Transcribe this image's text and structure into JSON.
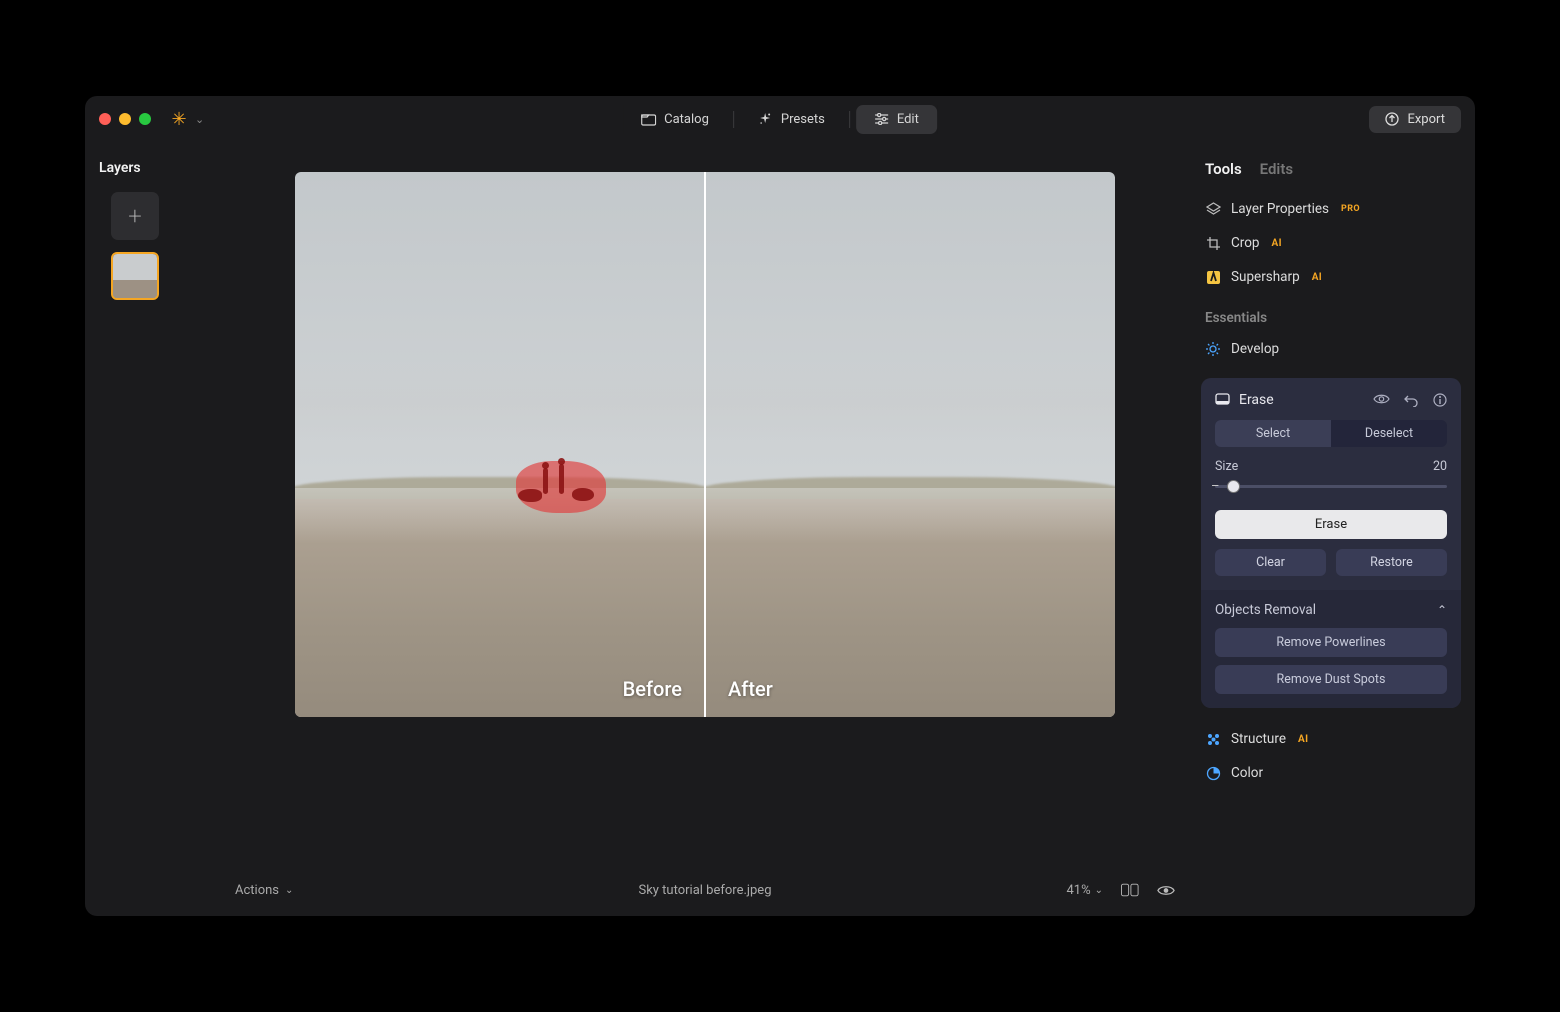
{
  "titlebar": {
    "tabs": {
      "catalog": "Catalog",
      "presets": "Presets",
      "edit": "Edit"
    },
    "export": "Export"
  },
  "left": {
    "heading": "Layers"
  },
  "canvas": {
    "before_label": "Before",
    "after_label": "After"
  },
  "bottombar": {
    "actions": "Actions",
    "filename": "Sky tutorial before.jpeg",
    "zoom": "41%"
  },
  "right": {
    "tabs": {
      "tools": "Tools",
      "edits": "Edits"
    },
    "tool_layer_properties": "Layer Properties",
    "badge_pro": "PRO",
    "tool_crop": "Crop",
    "badge_ai": "AI",
    "tool_supersharp": "Supersharp",
    "section_essentials": "Essentials",
    "tool_develop": "Develop",
    "erase": {
      "title": "Erase",
      "mode_select": "Select",
      "mode_deselect": "Deselect",
      "size_label": "Size",
      "size_value": "20",
      "erase_btn": "Erase",
      "clear_btn": "Clear",
      "restore_btn": "Restore",
      "objects_removal": "Objects Removal",
      "remove_powerlines": "Remove Powerlines",
      "remove_dust": "Remove Dust Spots"
    },
    "tool_structure": "Structure",
    "tool_color": "Color"
  }
}
